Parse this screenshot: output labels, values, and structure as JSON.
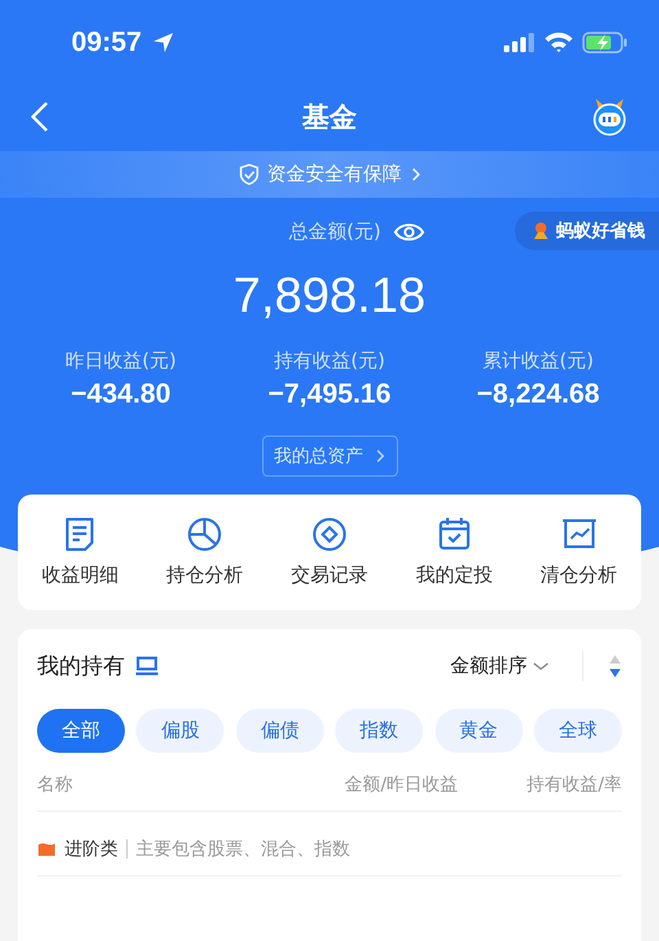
{
  "status_bar": {
    "time": "09:57"
  },
  "nav": {
    "title": "基金"
  },
  "banner": {
    "text": "资金安全有保障"
  },
  "promo_badge": {
    "text": "蚂蚁好省钱"
  },
  "total": {
    "label": "总金额(元)",
    "value": "7,898.18"
  },
  "stats": [
    {
      "label": "昨日收益(元)",
      "value": "−434.80"
    },
    {
      "label": "持有收益(元)",
      "value": "−7,495.16"
    },
    {
      "label": "累计收益(元)",
      "value": "−8,224.68"
    }
  ],
  "assets_button": {
    "label": "我的总资产"
  },
  "shortcuts": [
    {
      "kind": "doc",
      "label": "收益明细"
    },
    {
      "kind": "pie",
      "label": "持仓分析"
    },
    {
      "kind": "coin",
      "label": "交易记录"
    },
    {
      "kind": "calendar",
      "label": "我的定投"
    },
    {
      "kind": "chart",
      "label": "清仓分析"
    }
  ],
  "holdings": {
    "title": "我的持有",
    "sort": "金额排序",
    "filters": [
      {
        "label": "全部",
        "selected": true
      },
      {
        "label": "偏股",
        "selected": false
      },
      {
        "label": "偏债",
        "selected": false
      },
      {
        "label": "指数",
        "selected": false
      },
      {
        "label": "黄金",
        "selected": false
      },
      {
        "label": "全球",
        "selected": false
      }
    ],
    "columns": [
      "名称",
      "金额/昨日收益",
      "持有收益/率"
    ],
    "category": {
      "name": "进阶类",
      "description": "主要包含股票、混合、指数"
    }
  }
}
